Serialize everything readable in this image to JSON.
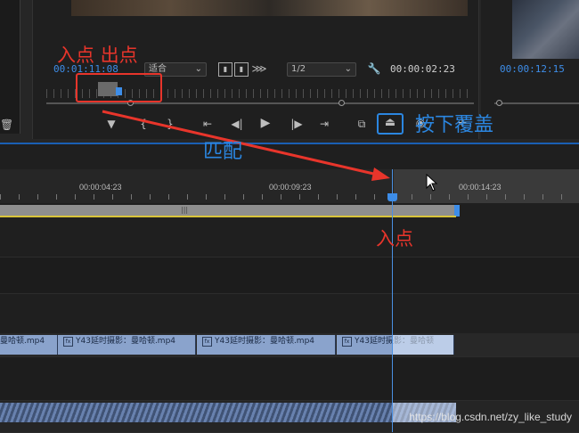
{
  "program_monitor": {
    "current_timecode": "00:01:11:08",
    "fit_dropdown": "适合",
    "resolution_dropdown": "1/2",
    "duration_timecode": "00:00:02:23",
    "source_timecode": "00:00:12:15"
  },
  "transport": {
    "icons": [
      "marker-icon",
      "mark-in-icon",
      "mark-out-icon",
      "go-to-in-icon",
      "step-back-icon",
      "play-icon",
      "step-forward-icon",
      "go-to-out-icon",
      "lift-icon",
      "overwrite-icon",
      "export-frame-icon",
      "add-icon"
    ]
  },
  "timeline": {
    "ruler_labels": [
      "00:00:04:23",
      "00:00:09:23",
      "00:00:14:23"
    ],
    "clips": [
      {
        "label": "曼哈顿.mp4"
      },
      {
        "label": "Y43延时摄影：曼哈顿.mp4"
      },
      {
        "label": "Y43延时摄影：曼哈顿.mp4"
      },
      {
        "label": "Y43延时摄影：曼哈顿"
      }
    ],
    "workbar_mark": "|||"
  },
  "annotations": {
    "in_out_label": "入点 出点",
    "match_label": "匹配",
    "press_overwrite_label": "按下覆盖",
    "in_point_label": "入点"
  },
  "watermark": "https://blog.csdn.net/zy_like_study",
  "colors": {
    "accent_blue": "#3d8de8",
    "annotation_red": "#e8352b",
    "clip_blue": "#8aa3cc",
    "workbar_yellow": "#d8c43a"
  }
}
